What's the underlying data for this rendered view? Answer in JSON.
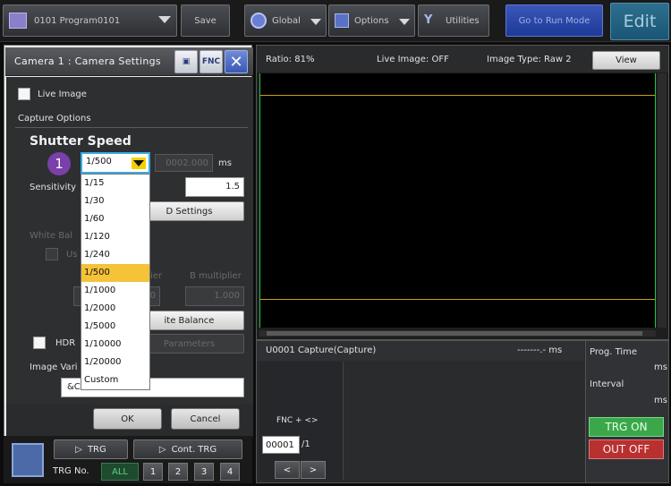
{
  "toolbar": {
    "program": "0101 Program0101",
    "save": "Save",
    "global": "Global",
    "options": "Options",
    "utilities": "Utilities",
    "run_mode": "Go to Run Mode",
    "edit": "Edit"
  },
  "camera_panel": {
    "title": "Camera 1 : Camera Settings",
    "fnc_button": "FNC",
    "live_image": "Live Image",
    "capture_options": "Capture Options",
    "shutter_speed_title": "Shutter Speed",
    "callout_number": "1",
    "shutter_selected": "1/500",
    "shutter_value": "0002.000",
    "shutter_unit": "ms",
    "sensitivity_label": "Sensitivity",
    "sensitivity_value": "1.5",
    "hdr_settings_btn": "D Settings",
    "white_balance_label": "White Bal",
    "use_label": "Us",
    "r_multiplier": "ier",
    "b_multiplier_label": "B multiplier",
    "r_value": "0",
    "b_value": "1.000",
    "white_balance_btn": "ite Balance",
    "hdr_label": "HDR",
    "parameters_btn": "Parameters",
    "image_variable_label": "Image Vari",
    "image_variable_value": "&Ca",
    "ok": "OK",
    "cancel": "Cancel"
  },
  "shutter_options": [
    "1/15",
    "1/30",
    "1/60",
    "1/120",
    "1/240",
    "1/500",
    "1/1000",
    "1/2000",
    "1/5000",
    "1/10000",
    "1/20000",
    "Custom"
  ],
  "trigger": {
    "trg": "TRG",
    "cont_trg": "Cont. TRG",
    "trg_no": "TRG No.",
    "all": "ALL",
    "nums": [
      "1",
      "2",
      "3",
      "4"
    ]
  },
  "image_view": {
    "ratio": "Ratio: 81%",
    "live_image": "Live Image: OFF",
    "image_type": "Image Type: Raw 2",
    "view": "View"
  },
  "unit_panel": {
    "unit": "U0001 Capture(Capture)",
    "time": "-------.- ms",
    "prog_time": "Prog. Time",
    "ms1": "ms",
    "interval": "Interval",
    "ms2": "ms",
    "fnc_label": "FNC + <>",
    "index_value": "00001",
    "index_total": "/1",
    "prev": "<",
    "next": ">",
    "trg_on": "TRG ON",
    "out_off": "OUT OFF"
  },
  "colors": {
    "selected_item": "#f5c238",
    "callout": "#7a3fa8",
    "trg_on": "#3aa84a",
    "out_off": "#b83030"
  }
}
